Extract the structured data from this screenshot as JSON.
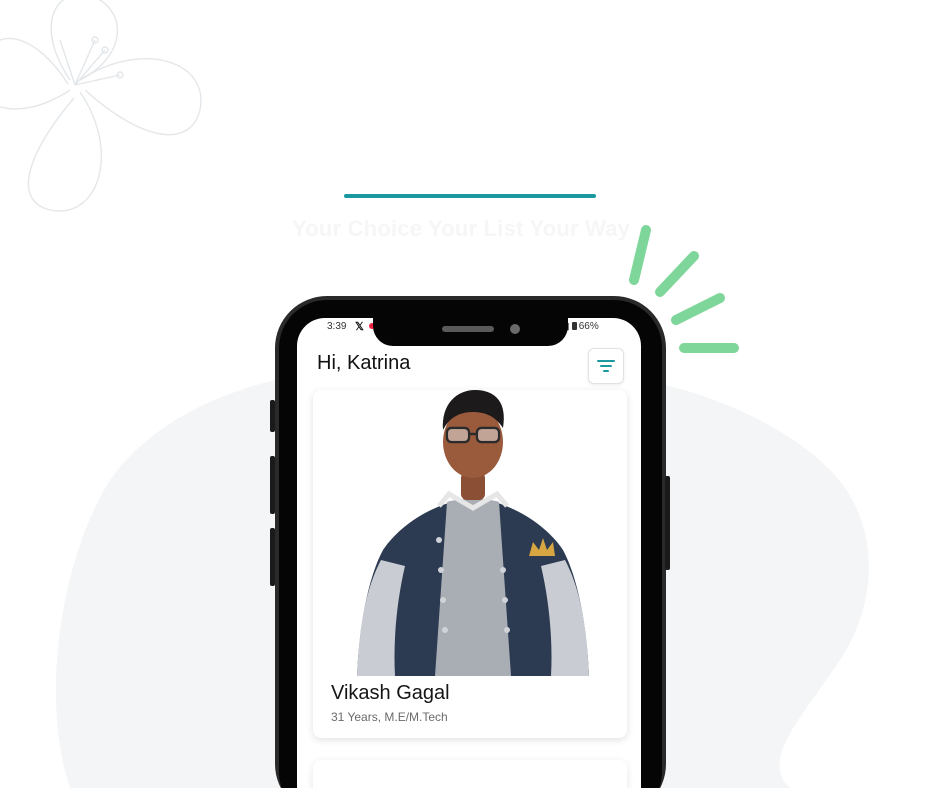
{
  "colors": {
    "accent": "#1a9aa0",
    "dash_green": "#7fd69a",
    "blob": "#f4f5f6"
  },
  "header": {
    "tagline": "Your Choice Your List Your Way"
  },
  "status_bar": {
    "time": "3:39",
    "x_icon": "𝕏",
    "battery": "66%"
  },
  "app": {
    "greeting": "Hi, Katrina",
    "filter_icon": "filter-icon"
  },
  "profile_card": {
    "name": "Vikash Gagal",
    "details": "31 Years, M.E/M.Tech"
  }
}
